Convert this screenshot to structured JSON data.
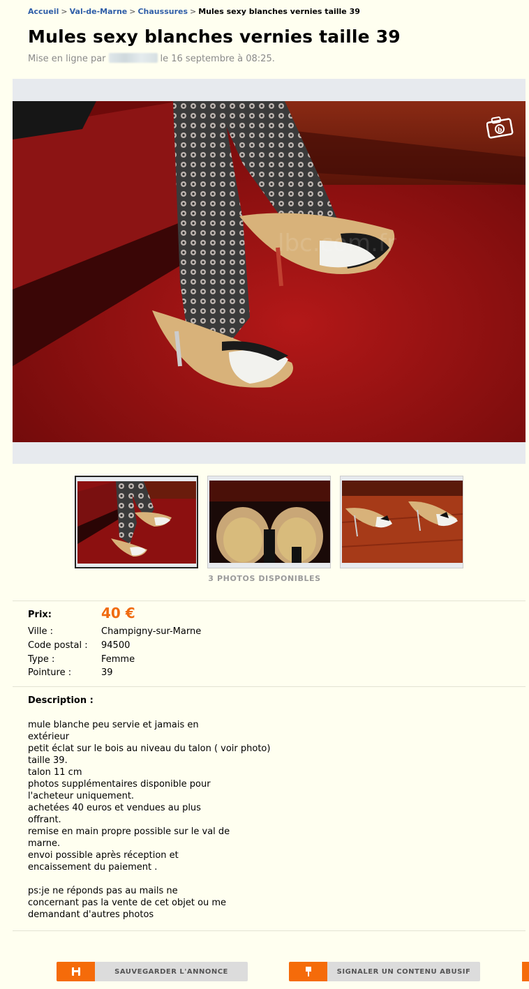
{
  "breadcrumb": {
    "items": [
      "Accueil",
      "Val-de-Marne",
      "Chaussures"
    ],
    "separator": ">",
    "current": "Mules sexy blanches vernies taille 39"
  },
  "ad": {
    "title": "Mules sexy blanches vernies taille 39",
    "posted_prefix": "Mise en ligne par",
    "posted_date": "le 16 septembre à 08:25."
  },
  "gallery": {
    "photo_count_label": "3 PHOTOS DISPONIBLES",
    "camera_icon": "camera-icon",
    "thumbnails": [
      "thumbnail-1",
      "thumbnail-2",
      "thumbnail-3"
    ]
  },
  "details": {
    "price_label": "Prix:",
    "price_value": "40 €",
    "rows": [
      {
        "label": "Ville :",
        "value": "Champigny-sur-Marne"
      },
      {
        "label": "Code postal :",
        "value": "94500"
      },
      {
        "label": "Type :",
        "value": "Femme"
      },
      {
        "label": "Pointure :",
        "value": "39"
      }
    ]
  },
  "description": {
    "title": "Description :",
    "lines": [
      "mule blanche peu servie et jamais en",
      "extérieur",
      "petit éclat sur le bois au niveau du talon ( voir photo)",
      "taille 39.",
      "talon 11 cm",
      "photos supplémentaires disponible pour",
      "l'acheteur uniquement.",
      "achetées 40 euros et vendues au plus",
      "offrant.",
      "remise en main propre possible sur le val de",
      "marne.",
      "envoi possible après réception et",
      "encaissement du paiement .",
      "",
      "ps:je ne réponds pas au mails ne",
      "concernant pas la vente de cet objet ou me",
      "demandant d'autres photos"
    ]
  },
  "actions": {
    "save_label": "SAUVEGARDER L'ANNONCE",
    "report_label": "SIGNALER UN CONTENU ABUSIF"
  },
  "colors": {
    "accent": "#f56b0a",
    "price": "#f06b10",
    "link": "#2f5ea8",
    "background": "#fffff0"
  }
}
